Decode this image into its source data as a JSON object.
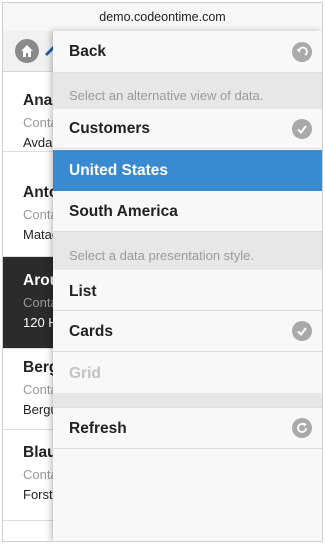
{
  "browser": {
    "url": "demo.codeontime.com"
  },
  "background_list": [
    {
      "title": "Ana",
      "sub": "Conta",
      "value": "Avda"
    },
    {
      "title": "Anto",
      "sub": "Conta",
      "value": "Matad"
    },
    {
      "title": "Arou",
      "sub": "Conta",
      "value": "120 H"
    },
    {
      "title": "Berg",
      "sub": "Conta",
      "value": "Bergu"
    },
    {
      "title": "Blau",
      "sub": "Conta",
      "value": "Forst"
    }
  ],
  "menu": {
    "back_label": "Back",
    "views_header": "Select an alternative view of data.",
    "views": [
      {
        "label": "Customers",
        "checked": true
      },
      {
        "label": "United States",
        "active": true
      },
      {
        "label": "South America"
      }
    ],
    "styles_header": "Select a data presentation style.",
    "styles": [
      {
        "label": "List"
      },
      {
        "label": "Cards",
        "checked": true
      },
      {
        "label": "Grid",
        "disabled": true
      }
    ],
    "refresh_label": "Refresh"
  },
  "colors": {
    "active": "#3a8ad1",
    "selected_row": "#2b2b2b",
    "icon_gray": "#a9a9a9"
  }
}
